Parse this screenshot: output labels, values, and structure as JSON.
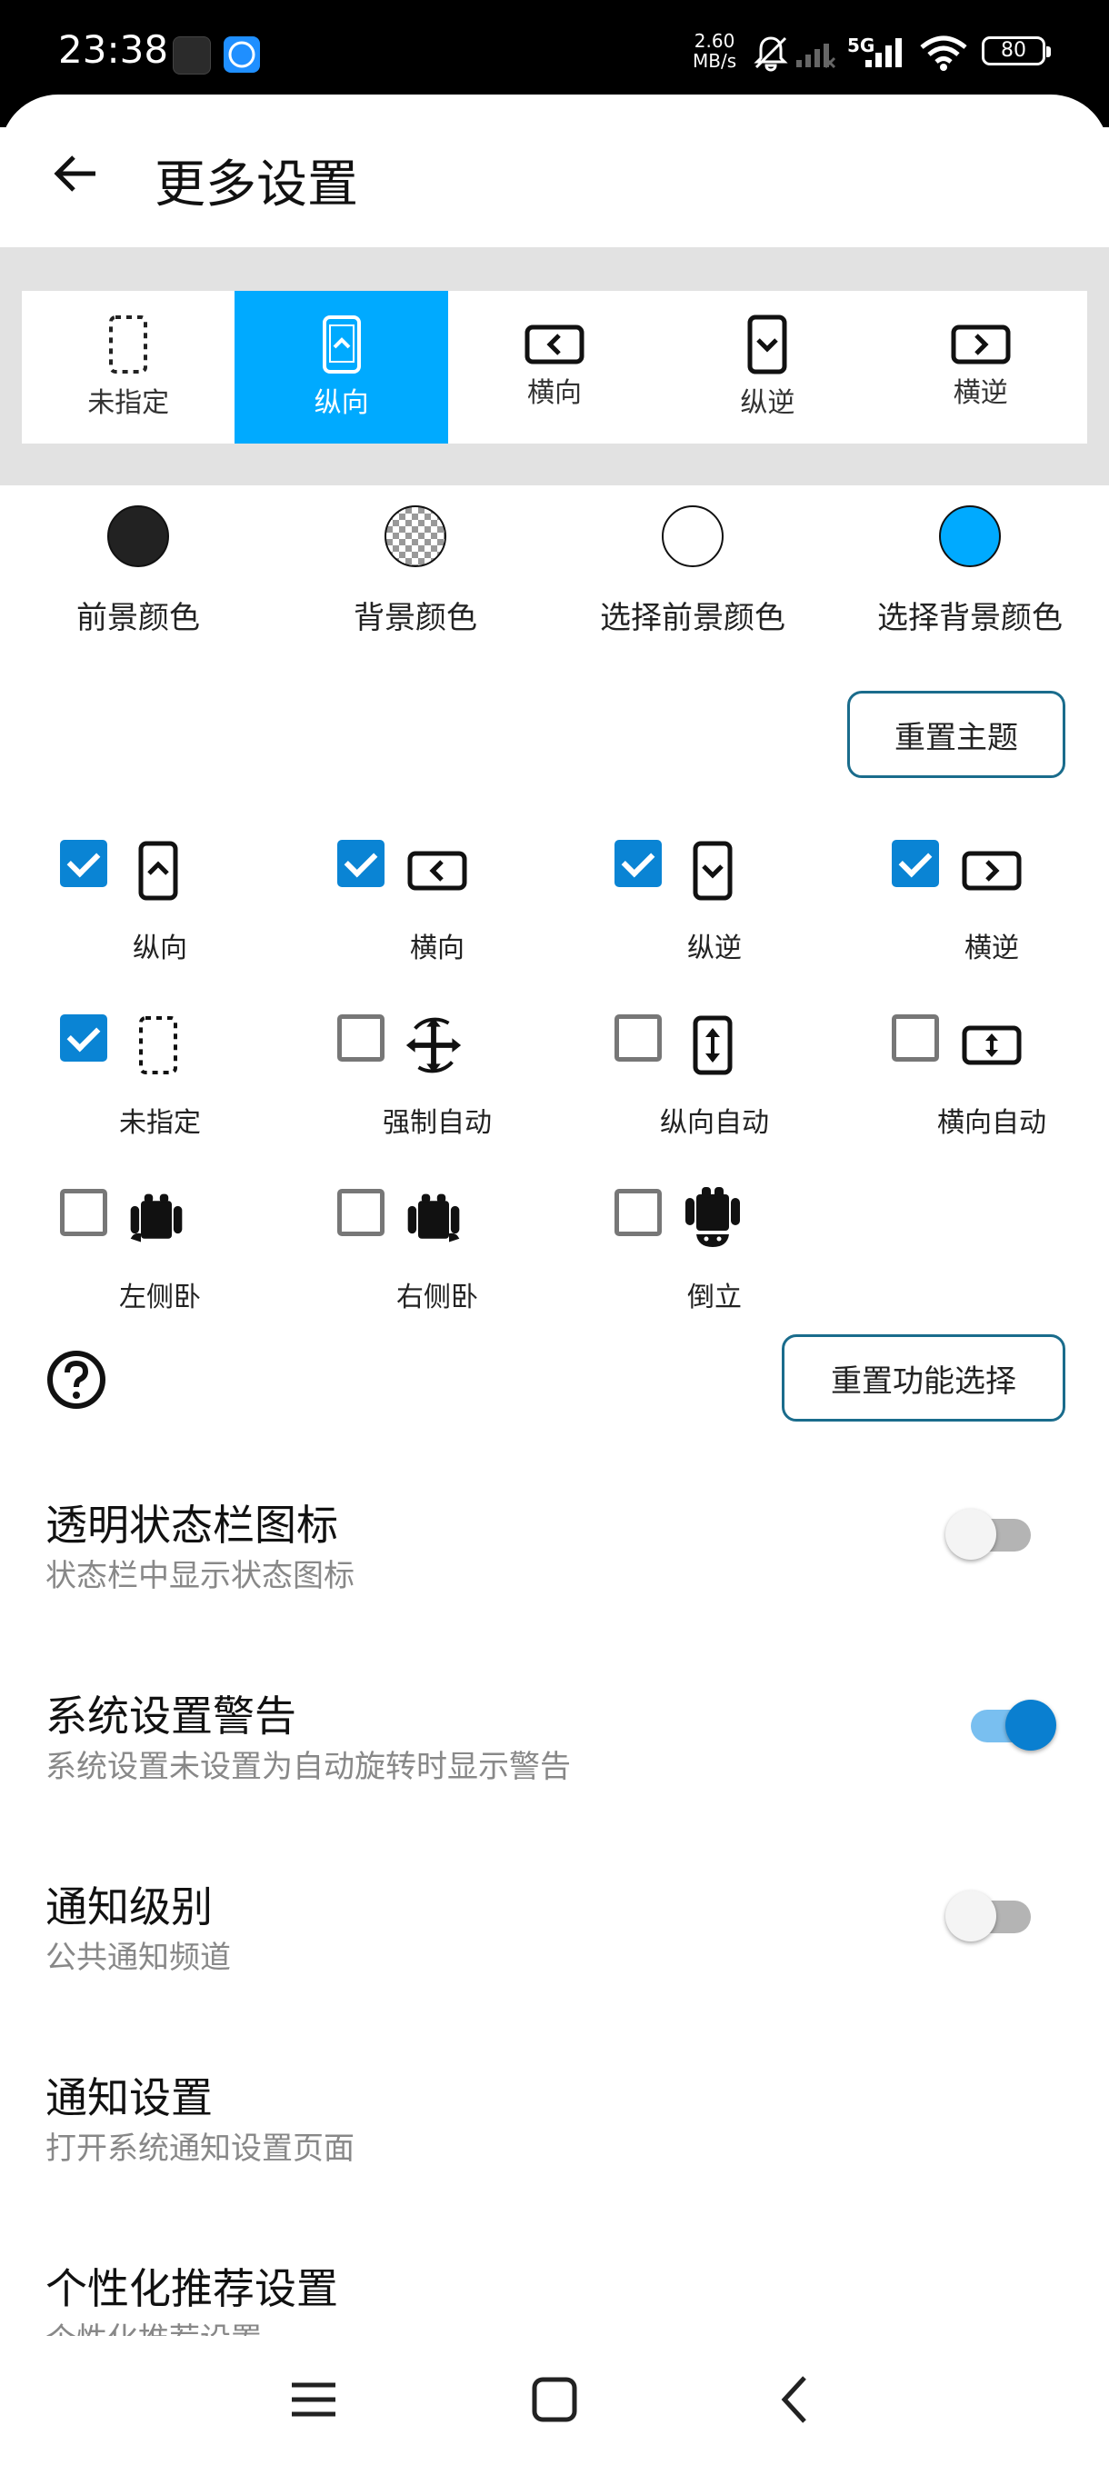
{
  "status_bar": {
    "time": "23:38",
    "speed_value": "2.60",
    "speed_unit": "MB/s",
    "network": "5G",
    "battery": "80"
  },
  "app_bar": {
    "title": "更多设置"
  },
  "orientations": [
    {
      "label": "未指定",
      "icon": "dotted-phone-icon",
      "selected": false
    },
    {
      "label": "纵向",
      "icon": "portrait-phone-icon",
      "selected": true
    },
    {
      "label": "横向",
      "icon": "landscape-phone-icon",
      "selected": false
    },
    {
      "label": "纵逆",
      "icon": "reverse-portrait-phone-icon",
      "selected": false
    },
    {
      "label": "横逆",
      "icon": "reverse-landscape-phone-icon",
      "selected": false
    }
  ],
  "colors": {
    "accent": "#00aaff",
    "toggle_on": "#0a7fd0",
    "checkbox_on": "#0a84d4",
    "foreground": "#222222",
    "selected_foreground": "#ffffff",
    "selected_background": "#00aaff"
  },
  "swatches": [
    {
      "label": "前景颜色"
    },
    {
      "label": "背景颜色"
    },
    {
      "label": "选择前景颜色"
    },
    {
      "label": "选择背景颜色"
    }
  ],
  "reset_theme_label": "重置主题",
  "features": [
    {
      "label": "纵向",
      "checked": true,
      "icon": "portrait-phone-icon"
    },
    {
      "label": "横向",
      "checked": true,
      "icon": "landscape-phone-icon"
    },
    {
      "label": "纵逆",
      "checked": true,
      "icon": "reverse-portrait-phone-icon"
    },
    {
      "label": "横逆",
      "checked": true,
      "icon": "reverse-landscape-phone-icon"
    },
    {
      "label": "未指定",
      "checked": true,
      "icon": "dotted-phone-icon"
    },
    {
      "label": "强制自动",
      "checked": false,
      "icon": "rotate-arrows-icon"
    },
    {
      "label": "纵向自动",
      "checked": false,
      "icon": "portrait-auto-icon"
    },
    {
      "label": "横向自动",
      "checked": false,
      "icon": "landscape-auto-icon"
    },
    {
      "label": "左侧卧",
      "checked": false,
      "icon": "android-left-icon"
    },
    {
      "label": "右侧卧",
      "checked": false,
      "icon": "android-right-icon"
    },
    {
      "label": "倒立",
      "checked": false,
      "icon": "android-upside-down-icon"
    }
  ],
  "reset_features_label": "重置功能选择",
  "settings": [
    {
      "title": "透明状态栏图标",
      "subtitle": "状态栏中显示状态图标",
      "toggle": false
    },
    {
      "title": "系统设置警告",
      "subtitle": "系统设置未设置为自动旋转时显示警告",
      "toggle": true
    },
    {
      "title": "通知级别",
      "subtitle": "公共通知频道",
      "toggle": false
    },
    {
      "title": "通知设置",
      "subtitle": "打开系统通知设置页面"
    },
    {
      "title": "个性化推荐设置",
      "subtitle": "个性化推荐设置"
    }
  ]
}
